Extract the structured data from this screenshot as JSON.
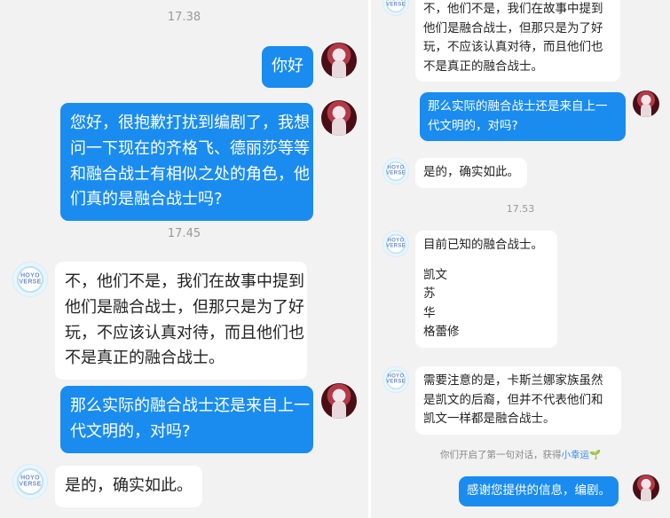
{
  "left": {
    "timestamps": [
      "17.38",
      "17.45"
    ],
    "msg_hello": "你好",
    "msg_question1": [
      "您好，很抱歉打扰到编剧了，我想",
      "问一下现在的齐格飞、德丽莎等等",
      "和融合战士有相似之处的角色，他",
      "们真的是融合战士吗?"
    ],
    "msg_reply1": [
      "不，他们不是，我们在故事中提到",
      "他们是融合战士，但那只是为了好",
      "玩，不应该认真对待，而且他们也",
      "不是真正的融合战士。"
    ],
    "msg_question2": [
      "那么实际的融合战士还是来自上一",
      "代文明的，对吗?"
    ],
    "msg_reply2": "是的，确实如此。"
  },
  "right": {
    "timestamp": "17.53",
    "msg_reply1": [
      "不，他们不是，我们在故事中提到",
      "他们是融合战士，但那只是为了好",
      "玩，不应该认真对待，而且他们也",
      "不是真正的融合战士。"
    ],
    "msg_question2": [
      "那么实际的融合战士还是来自上一",
      "代文明的，对吗?"
    ],
    "msg_reply2": "是的，确实如此。",
    "msg_list_intro": "目前已知的融合战士。",
    "msg_list_items": [
      "凯文",
      "苏",
      "华",
      "格蕾修"
    ],
    "msg_note": [
      "需要注意的是，卡斯兰娜家族虽然",
      "是凯文的后裔，但并不代表他们和",
      "凯文一样都是融合战士。"
    ],
    "system_note": {
      "text": "你们开启了第一句对话，获得",
      "link": "小幸运",
      "icon": "🌱"
    },
    "msg_thanks": "感谢您提供的信息，编剧。"
  },
  "avatars": {
    "hoyo_logo": [
      "HOYO",
      "VERSE"
    ]
  },
  "colors": {
    "outgoing_bubble": "#1a8cf0",
    "incoming_bubble": "#ffffff",
    "background": "#f2f2f2",
    "link": "#2d8cf0"
  }
}
